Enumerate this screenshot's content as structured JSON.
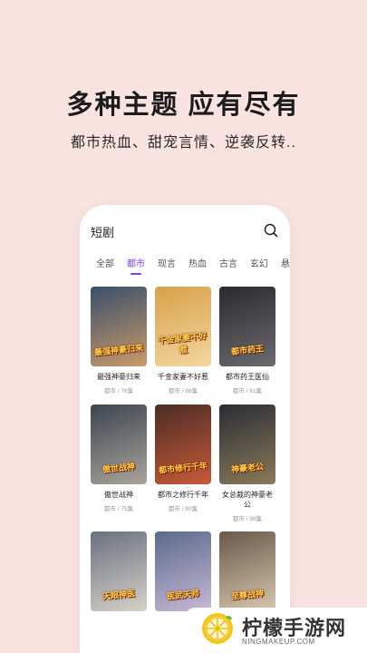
{
  "headline": "多种主题 应有尽有",
  "subhead": "都市热血、甜宠言情、逆袭反转..",
  "app": {
    "title": "短剧",
    "search_icon": "search-icon",
    "accent_color": "#7a3ff2"
  },
  "tabs": [
    {
      "label": "全部",
      "active": false
    },
    {
      "label": "都市",
      "active": true
    },
    {
      "label": "现言",
      "active": false
    },
    {
      "label": "热血",
      "active": false
    },
    {
      "label": "古言",
      "active": false
    },
    {
      "label": "玄幻",
      "active": false
    },
    {
      "label": "悬",
      "active": false
    }
  ],
  "dramas": [
    {
      "title": "最强神豪归来",
      "meta": "都市 / 76集",
      "poster_text": "最强神豪归来",
      "poster_colors": [
        "#3a4f6b",
        "#c99a6a"
      ]
    },
    {
      "title": "千金家妻不好惹",
      "meta": "都市 / 88集",
      "poster_text": "千金家妻不好惹",
      "poster_colors": [
        "#d8a14a",
        "#f3d7a0"
      ]
    },
    {
      "title": "都市药王医仙",
      "meta": "都市 / 61集",
      "poster_text": "都市药王",
      "poster_colors": [
        "#2b2b2f",
        "#6a6a70"
      ]
    },
    {
      "title": "傲世战神",
      "meta": "都市 / 75集",
      "poster_text": "傲世战神",
      "poster_colors": [
        "#3d4550",
        "#a9a49c"
      ]
    },
    {
      "title": "都市之修行千年",
      "meta": "都市 / 80集",
      "poster_text": "都市修行千年",
      "poster_colors": [
        "#4a2c24",
        "#c95a3a"
      ]
    },
    {
      "title": "女总裁的神豪老公",
      "meta": "都市 / 98集",
      "poster_text": "神豪老公",
      "poster_colors": [
        "#2a2d34",
        "#8a7a5a"
      ]
    },
    {
      "title": "",
      "meta": "",
      "poster_text": "天眼神医",
      "poster_colors": [
        "#6a7080",
        "#d6d2c8"
      ]
    },
    {
      "title": "",
      "meta": "",
      "poster_text": "医武天师",
      "poster_colors": [
        "#5b6a8a",
        "#c8b8d8"
      ]
    },
    {
      "title": "",
      "meta": "",
      "poster_text": "至尊战神",
      "poster_colors": [
        "#6a5848",
        "#d8c8b0"
      ]
    }
  ],
  "watermark": {
    "name": "柠檬手游网",
    "url": "NINGMAKEUP.COM"
  }
}
